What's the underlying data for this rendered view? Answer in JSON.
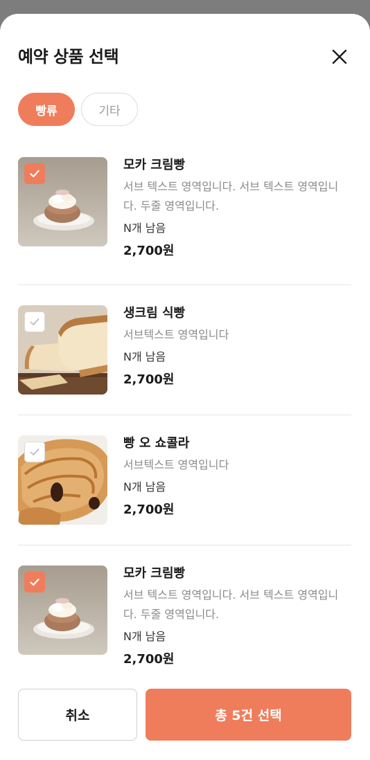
{
  "header": {
    "title": "예약 상품 선택",
    "close_icon": "close-icon"
  },
  "tabs": [
    {
      "label": "빵류",
      "active": true
    },
    {
      "label": "기타",
      "active": false
    }
  ],
  "products": [
    {
      "name": "모카 크림빵",
      "sub": "서브 텍스트 영역입니다. 서브 텍스트 영역입니다. 두줄 영역입니다.",
      "stock": "N개 남음",
      "price": "2,700원",
      "checked": true,
      "image": "cream-bun"
    },
    {
      "name": "생크림 식빵",
      "sub": "서브텍스트 영역입니다",
      "stock": "N개 남음",
      "price": "2,700원",
      "checked": false,
      "image": "milk-bread"
    },
    {
      "name": "빵 오 쇼콜라",
      "sub": "서브텍스트 영역입니다",
      "stock": "N개 남음",
      "price": "2,700원",
      "checked": false,
      "image": "pain-au-chocolat"
    },
    {
      "name": "모카 크림빵",
      "sub": "서브 텍스트 영역입니다. 서브 텍스트 영역입니다. 두줄 영역입니다.",
      "stock": "N개 남음",
      "price": "2,700원",
      "checked": true,
      "image": "cream-bun"
    }
  ],
  "footer": {
    "cancel_label": "취소",
    "confirm_label": "총 5건 선택"
  },
  "colors": {
    "accent": "#ef7d5c",
    "scrim": "#7d7d7d"
  }
}
